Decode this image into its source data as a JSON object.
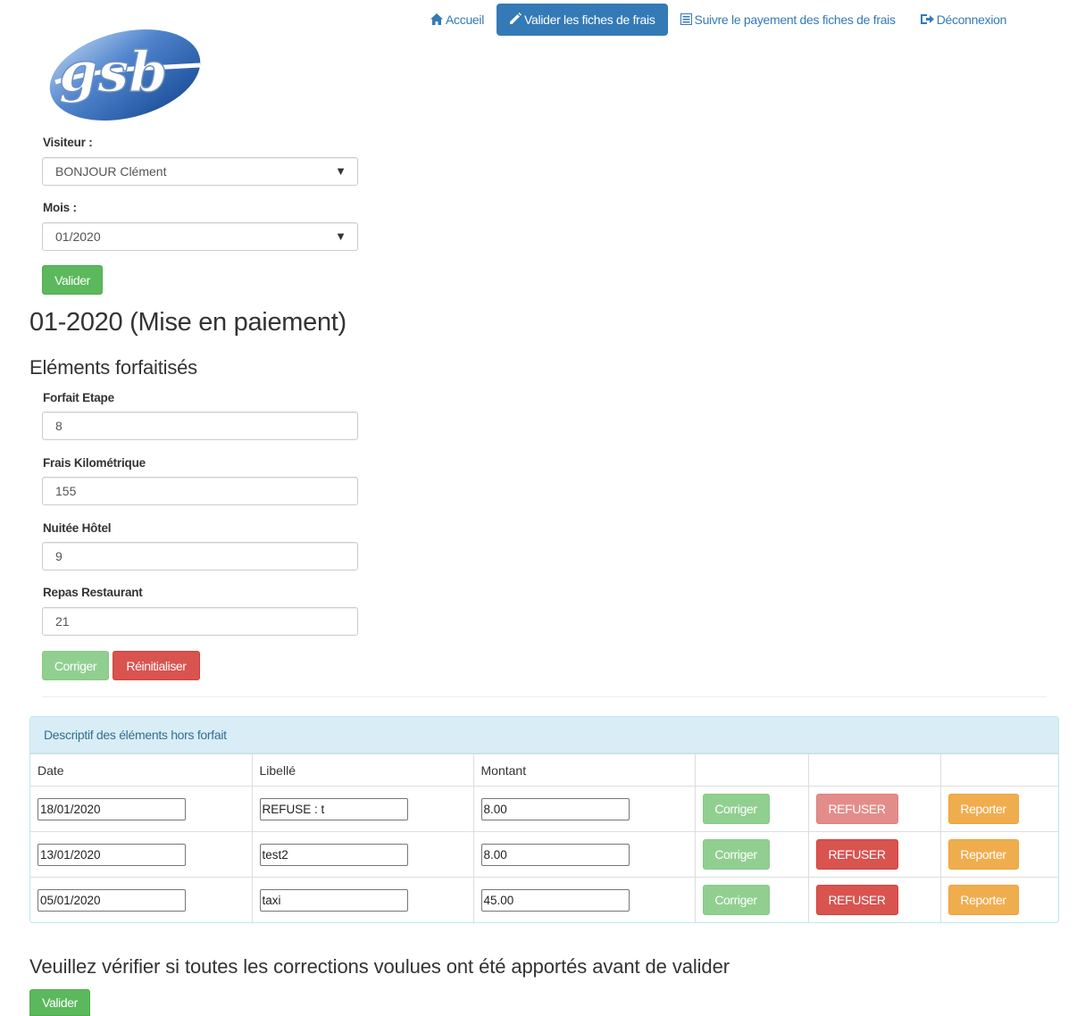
{
  "nav": {
    "items": [
      {
        "label": "Accueil",
        "icon": "home-icon"
      },
      {
        "label": "Valider les fiches de frais",
        "icon": "pencil-icon"
      },
      {
        "label": "Suivre le payement des fiches de frais",
        "icon": "list-icon"
      },
      {
        "label": "Déconnexion",
        "icon": "logout-icon"
      }
    ],
    "active_color": "#337ab7"
  },
  "logo": {
    "text": "gsb"
  },
  "form": {
    "visiteur_label": "Visiteur :",
    "visiteur_value": "BONJOUR Clément",
    "mois_label": "Mois :",
    "mois_value": "01/2020",
    "valider_label": "Valider"
  },
  "fiche": {
    "title": "01-2020 (Mise en paiement)",
    "forfait_heading": "Eléments forfaitisés",
    "forfaits": [
      {
        "label": "Forfait Etape",
        "value": "8"
      },
      {
        "label": "Frais Kilométrique",
        "value": "155"
      },
      {
        "label": "Nuitée Hôtel",
        "value": "9"
      },
      {
        "label": "Repas Restaurant",
        "value": "21"
      }
    ],
    "corriger_label": "Corriger",
    "reinitialiser_label": "Réinitialiser"
  },
  "hors_forfait": {
    "heading": "Descriptif des éléments hors forfait",
    "columns": [
      "Date",
      "Libellé",
      "Montant",
      "",
      "",
      ""
    ],
    "rows": [
      {
        "date": "18/01/2020",
        "libelle": "REFUSE : t",
        "montant": "8.00",
        "refused": true
      },
      {
        "date": "13/01/2020",
        "libelle": "test2",
        "montant": "8.00",
        "refused": false
      },
      {
        "date": "05/01/2020",
        "libelle": "taxi",
        "montant": "45.00",
        "refused": false
      }
    ],
    "corriger_label": "Corriger",
    "refuser_label": "REFUSER",
    "reporter_label": "Reporter"
  },
  "footer": {
    "notice": "Veuillez vérifier si toutes les corrections voulues ont été apportés avant de valider",
    "valider_label": "Valider"
  },
  "colors": {
    "success": "#5cb85c",
    "danger": "#d9534f",
    "warning": "#f0ad4e",
    "info_bg": "#d9edf7"
  }
}
